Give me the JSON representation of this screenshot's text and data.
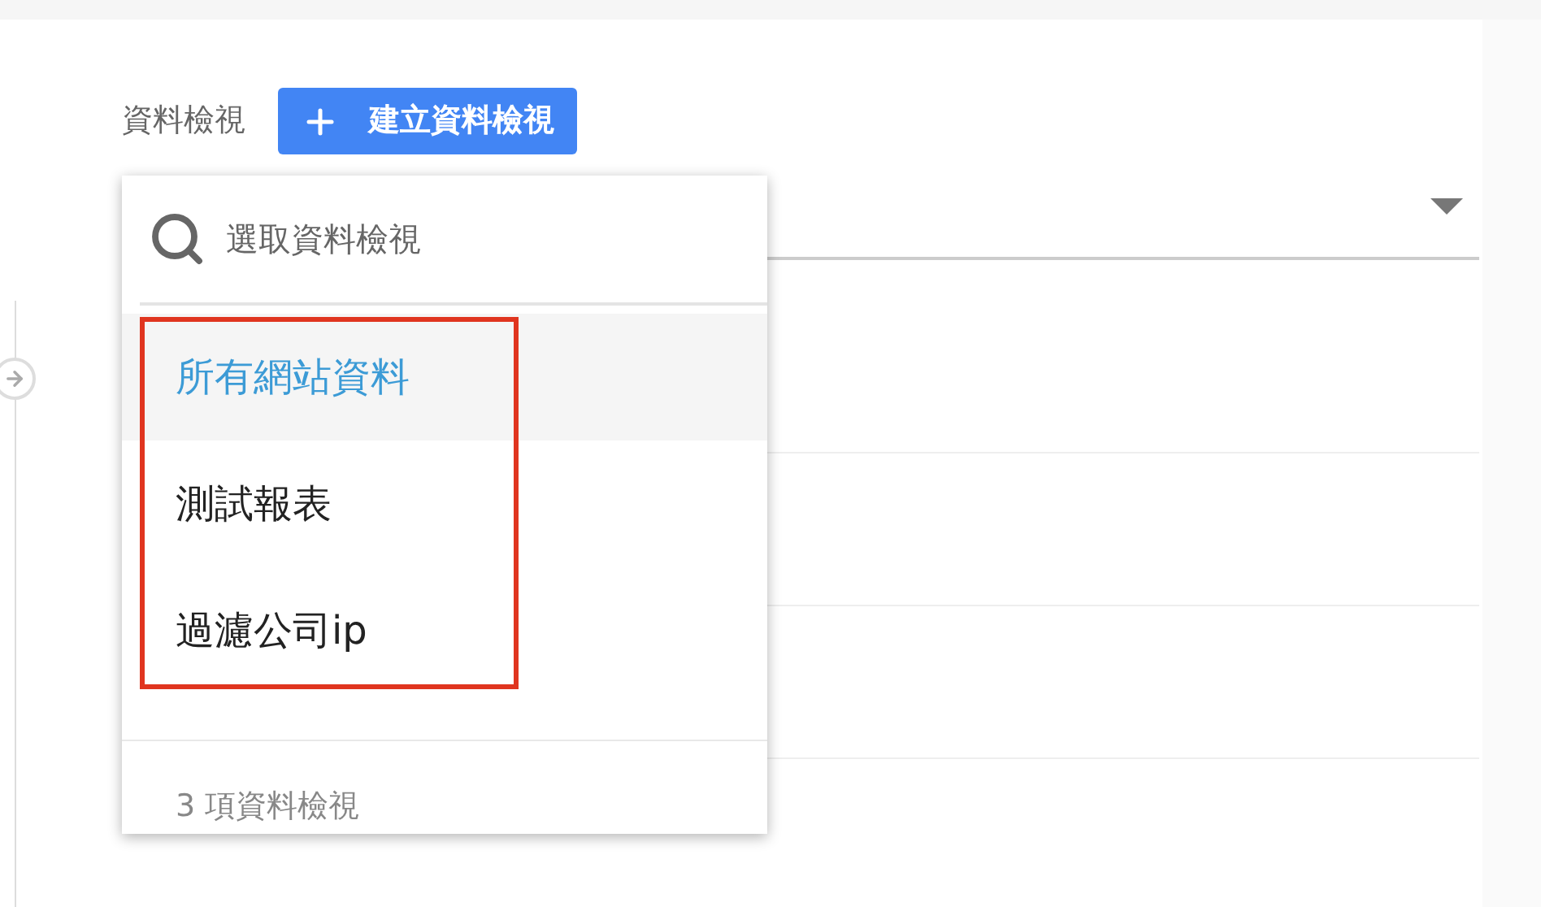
{
  "header": {
    "label": "資料檢視",
    "create_button": "建立資料檢視"
  },
  "view_picker": {
    "search": {
      "placeholder": "選取資料檢視"
    },
    "items": [
      {
        "label": "所有網站資料",
        "selected": true
      },
      {
        "label": "測試報表",
        "selected": false
      },
      {
        "label": "過濾公司ip",
        "selected": false
      }
    ],
    "count": "3 項資料檢視",
    "highlighted": true
  }
}
